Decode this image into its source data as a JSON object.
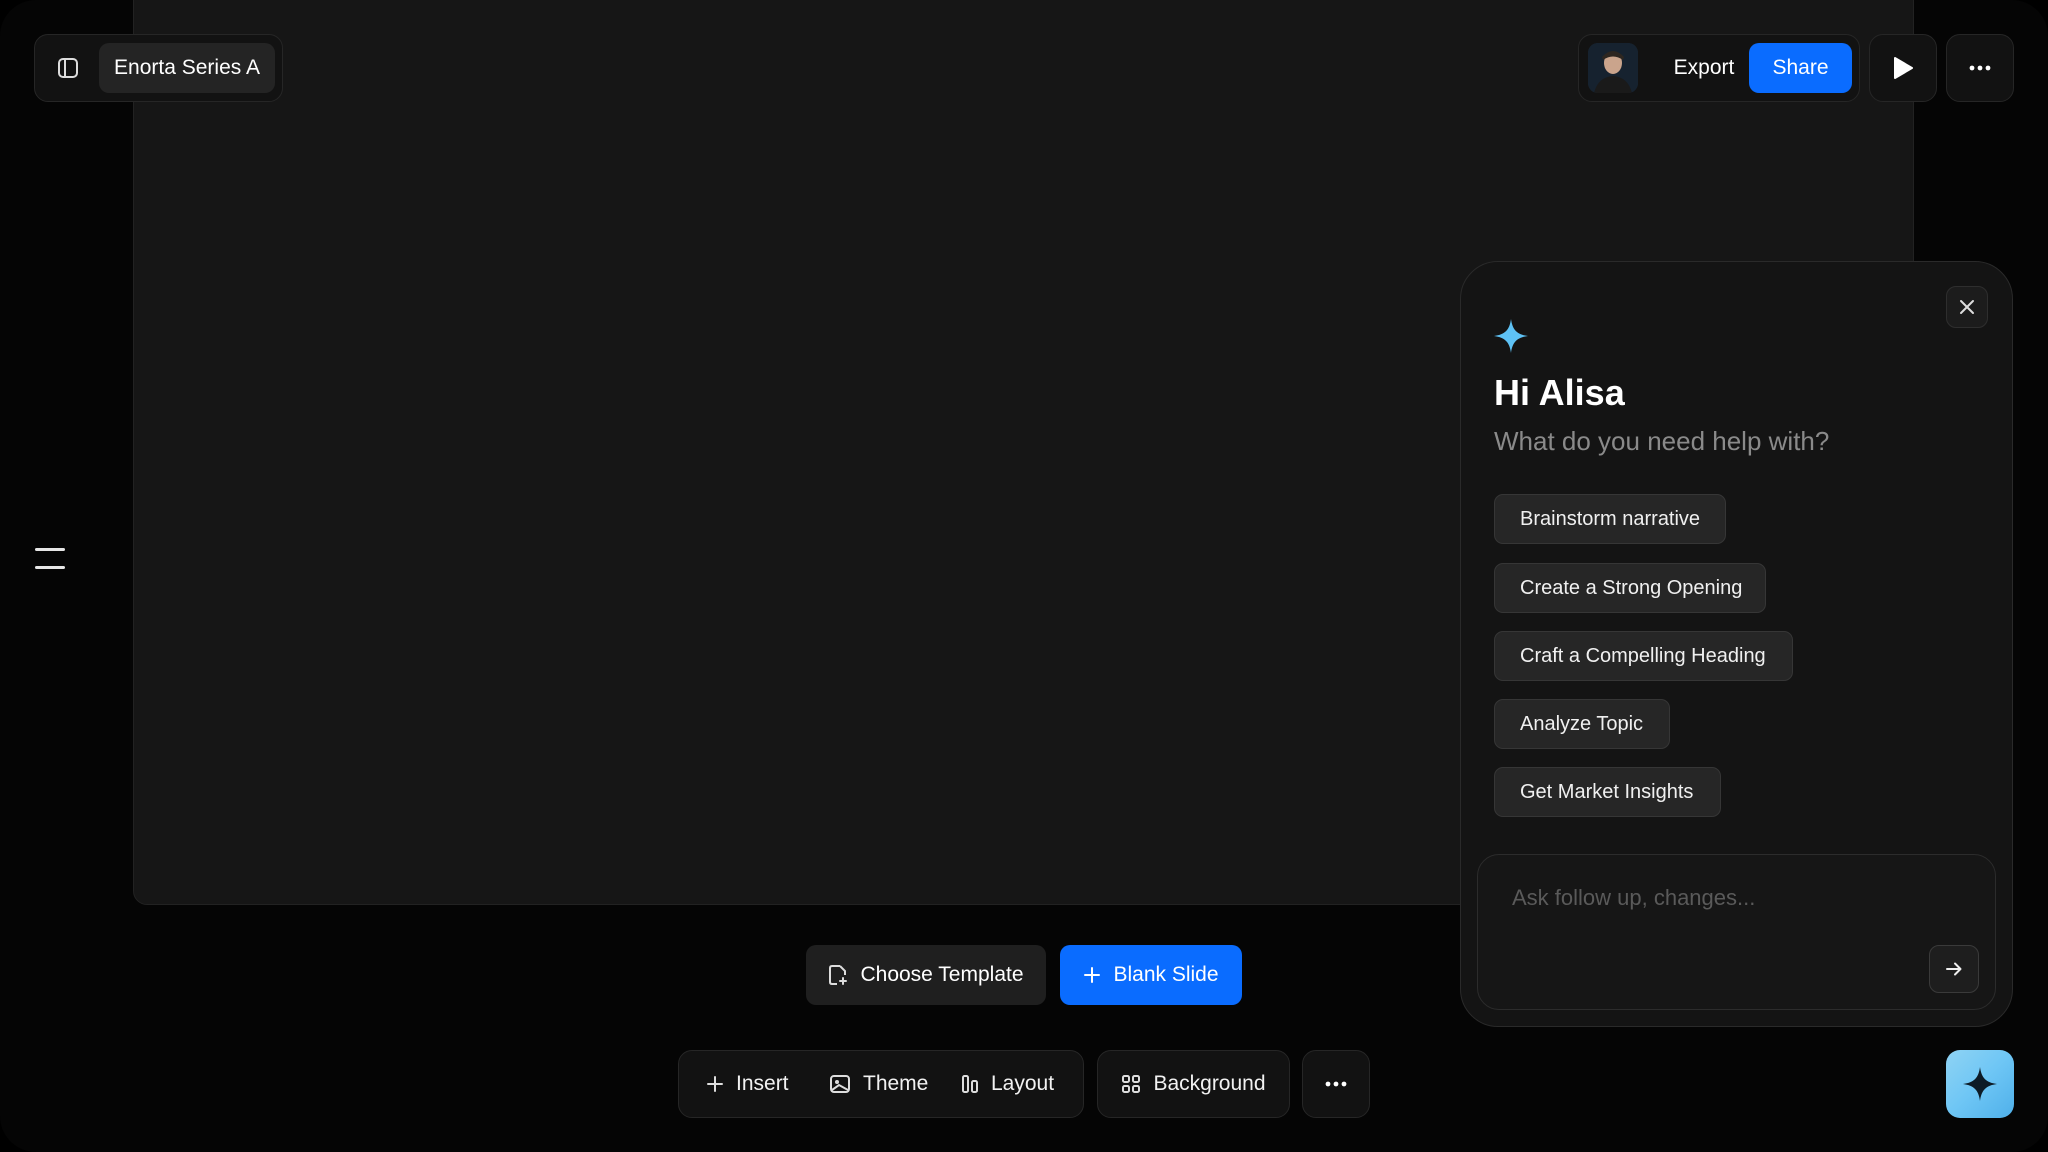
{
  "header": {
    "doc_title": "Enorta Series A",
    "export_label": "Export",
    "share_label": "Share"
  },
  "assistant": {
    "greeting": "Hi Alisa",
    "prompt": "What do you need help with?",
    "suggestions": [
      "Brainstorm narrative",
      "Create a Strong Opening",
      "Craft a Compelling Heading",
      "Analyze Topic",
      "Get Market Insights"
    ],
    "input_placeholder": "Ask follow up, changes..."
  },
  "slide_actions": {
    "choose_template_label": "Choose Template",
    "blank_slide_label": "Blank Slide"
  },
  "toolbar": {
    "insert_label": "Insert",
    "theme_label": "Theme",
    "layout_label": "Layout",
    "background_label": "Background"
  },
  "colors": {
    "accent_blue": "#0a6cff",
    "sparkle": "#5ec2f5",
    "background": "#050505"
  }
}
